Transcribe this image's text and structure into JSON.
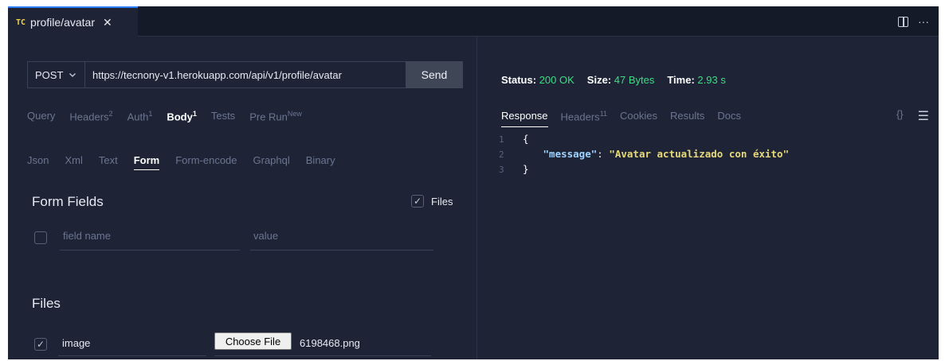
{
  "tab": {
    "badge": "TC",
    "title": "profile/avatar",
    "close": "✕"
  },
  "request": {
    "method": "POST",
    "url": "https://tecnony-v1.herokuapp.com/api/v1/profile/avatar",
    "send_label": "Send",
    "tabs": [
      {
        "label": "Query",
        "sup": ""
      },
      {
        "label": "Headers",
        "sup": "2"
      },
      {
        "label": "Auth",
        "sup": "1"
      },
      {
        "label": "Body",
        "sup": "1",
        "active": true
      },
      {
        "label": "Tests",
        "sup": ""
      },
      {
        "label": "Pre Run",
        "sup": "New"
      }
    ],
    "body_tabs": [
      "Json",
      "Xml",
      "Text",
      "Form",
      "Form-encode",
      "Graphql",
      "Binary"
    ],
    "body_active": "Form"
  },
  "form": {
    "title": "Form Fields",
    "files_toggle_label": "Files",
    "field_name_placeholder": "field name",
    "value_placeholder": "value"
  },
  "files": {
    "title": "Files",
    "rows": [
      {
        "name": "image",
        "choose_label": "Choose File",
        "file_name": "6198468.png"
      }
    ]
  },
  "response": {
    "status_label": "Status:",
    "status_value": "200 OK",
    "size_label": "Size:",
    "size_value": "47 Bytes",
    "time_label": "Time:",
    "time_value": "2.93 s",
    "tabs": [
      {
        "label": "Response",
        "sup": "",
        "active": true
      },
      {
        "label": "Headers",
        "sup": "11"
      },
      {
        "label": "Cookies",
        "sup": ""
      },
      {
        "label": "Results",
        "sup": ""
      },
      {
        "label": "Docs",
        "sup": ""
      }
    ],
    "code_lines": [
      {
        "num": "1",
        "open": "{"
      },
      {
        "num": "2",
        "key": "\"message\"",
        "value": "\"Avatar actualizado con éxito\""
      },
      {
        "num": "3",
        "close": "}"
      }
    ]
  },
  "colors": {
    "background": "#1e2436",
    "accent": "#2d7df6",
    "success": "#3ddc84",
    "badge": "#f0d24a",
    "json_key": "#9fd3ff",
    "json_string": "#e7d97a"
  },
  "icons": [
    "split-editor-icon",
    "more-icon",
    "chevron-down-icon",
    "checkbox-icon",
    "braces-icon",
    "menu-icon"
  ]
}
